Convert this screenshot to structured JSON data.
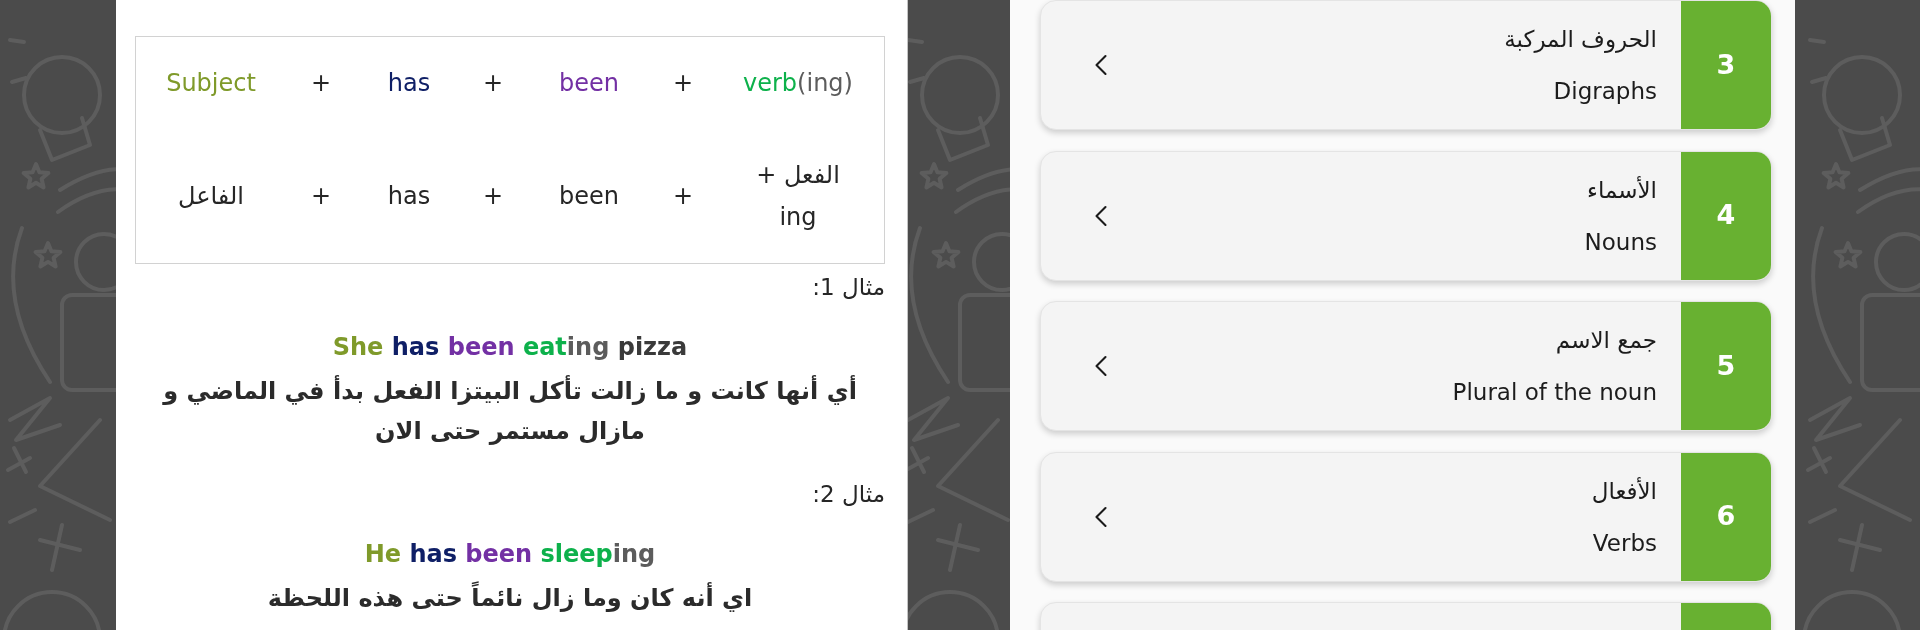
{
  "formula_table": {
    "rows": [
      {
        "highlighted": true,
        "subject": "Subject",
        "op_1": "+",
        "auxiliary": "has",
        "op_2": "+",
        "been": "been",
        "op_3": "+",
        "verb": "verb",
        "suffix": "(ing)"
      },
      {
        "highlighted": false,
        "subject": "الفاعل",
        "op_1": "+",
        "auxiliary": "has",
        "op_2": "+",
        "been": "been",
        "op_3": "+",
        "verb": "الفعل + ing"
      }
    ]
  },
  "examples": [
    {
      "label": "مثال 1:",
      "sentence": {
        "highlighted": true,
        "subject": "She",
        "auxiliary": "has",
        "been": "been",
        "verb": "eat",
        "suffix": "ing",
        "object": "pizza"
      },
      "translation": "أي أنها كانت و ما زالت تأكل البيتزا الفعل بدأ في الماضي و مازال مستمر حتى الان"
    },
    {
      "label": "مثال 2:",
      "sentence": {
        "highlighted": true,
        "subject": "He",
        "auxiliary": "has",
        "been": "been",
        "verb": "sleep",
        "suffix": "ing"
      },
      "translation": "اي أنه كان وما زال نائماً حتى هذه اللحظة"
    }
  ],
  "lessons": [
    {
      "number": "3",
      "title": "الحروف المركبة",
      "subtitle": "Digraphs"
    },
    {
      "number": "4",
      "title": "الأسماء",
      "subtitle": "Nouns"
    },
    {
      "number": "5",
      "title": "جمع الاسم",
      "subtitle": "Plural of the noun"
    },
    {
      "number": "6",
      "title": "الأفعال",
      "subtitle": "Verbs"
    }
  ]
}
